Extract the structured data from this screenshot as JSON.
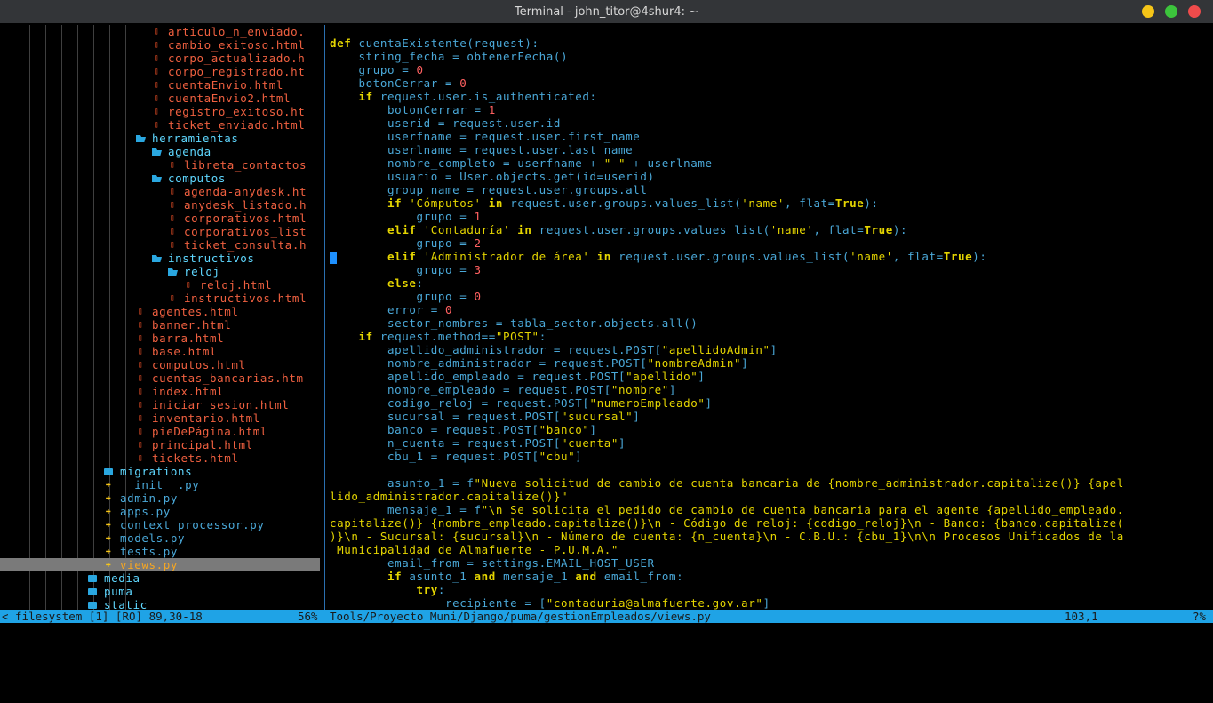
{
  "window": {
    "title": "Terminal - john_titor@4shur4: ~",
    "buttons": {
      "minimize_color": "#f5c518",
      "maximize_color": "#3cc43c",
      "close_color": "#ef4b4b"
    }
  },
  "tree": {
    "items": [
      {
        "name": "articulo_n_enviado.",
        "kind": "html",
        "indent": 10
      },
      {
        "name": "cambio_exitoso.html",
        "kind": "html",
        "indent": 10
      },
      {
        "name": "corpo_actualizado.h",
        "kind": "html",
        "indent": 10
      },
      {
        "name": "corpo_registrado.ht",
        "kind": "html",
        "indent": 10
      },
      {
        "name": "cuentaEnvio.html",
        "kind": "html",
        "indent": 10
      },
      {
        "name": "cuentaEnvio2.html",
        "kind": "html",
        "indent": 10
      },
      {
        "name": "registro_exitoso.ht",
        "kind": "html",
        "indent": 10
      },
      {
        "name": "ticket_enviado.html",
        "kind": "html",
        "indent": 10
      },
      {
        "name": "herramientas",
        "kind": "dir-open",
        "indent": 9
      },
      {
        "name": "agenda",
        "kind": "dir-open",
        "indent": 10
      },
      {
        "name": "libreta_contactos",
        "kind": "html",
        "indent": 11
      },
      {
        "name": "computos",
        "kind": "dir-open",
        "indent": 10
      },
      {
        "name": "agenda-anydesk.ht",
        "kind": "html",
        "indent": 11
      },
      {
        "name": "anydesk_listado.h",
        "kind": "html",
        "indent": 11
      },
      {
        "name": "corporativos.html",
        "kind": "html",
        "indent": 11
      },
      {
        "name": "corporativos_list",
        "kind": "html",
        "indent": 11
      },
      {
        "name": "ticket_consulta.h",
        "kind": "html",
        "indent": 11
      },
      {
        "name": "instructivos",
        "kind": "dir-open",
        "indent": 10
      },
      {
        "name": "reloj",
        "kind": "dir-open",
        "indent": 11
      },
      {
        "name": "reloj.html",
        "kind": "html",
        "indent": 12
      },
      {
        "name": "instructivos.html",
        "kind": "html",
        "indent": 11
      },
      {
        "name": "agentes.html",
        "kind": "html",
        "indent": 9
      },
      {
        "name": "banner.html",
        "kind": "html",
        "indent": 9
      },
      {
        "name": "barra.html",
        "kind": "html",
        "indent": 9
      },
      {
        "name": "base.html",
        "kind": "html",
        "indent": 9
      },
      {
        "name": "computos.html",
        "kind": "html",
        "indent": 9
      },
      {
        "name": "cuentas_bancarias.htm",
        "kind": "html",
        "indent": 9
      },
      {
        "name": "index.html",
        "kind": "html",
        "indent": 9
      },
      {
        "name": "iniciar_sesion.html",
        "kind": "html",
        "indent": 9
      },
      {
        "name": "inventario.html",
        "kind": "html",
        "indent": 9
      },
      {
        "name": "pieDePágina.html",
        "kind": "html",
        "indent": 9
      },
      {
        "name": "principal.html",
        "kind": "html",
        "indent": 9
      },
      {
        "name": "tickets.html",
        "kind": "html",
        "indent": 9
      },
      {
        "name": "migrations",
        "kind": "dir",
        "indent": 7
      },
      {
        "name": "__init__.py",
        "kind": "py",
        "indent": 7
      },
      {
        "name": "admin.py",
        "kind": "py",
        "indent": 7
      },
      {
        "name": "apps.py",
        "kind": "py",
        "indent": 7
      },
      {
        "name": "context_processor.py",
        "kind": "py",
        "indent": 7
      },
      {
        "name": "models.py",
        "kind": "py",
        "indent": 7
      },
      {
        "name": "tests.py",
        "kind": "py",
        "indent": 7
      },
      {
        "name": "views.py",
        "kind": "py",
        "indent": 7,
        "selected": true
      },
      {
        "name": "media",
        "kind": "dir",
        "indent": 6
      },
      {
        "name": "puma",
        "kind": "dir",
        "indent": 6
      },
      {
        "name": "static",
        "kind": "dir",
        "indent": 6
      }
    ]
  },
  "editor": {
    "lines": [
      [
        [
          "kw",
          "def "
        ],
        [
          "fn",
          "cuentaExistente"
        ],
        [
          "tx",
          "(request):"
        ]
      ],
      [
        [
          "tx",
          "    string_fecha = obtenerFecha()"
        ]
      ],
      [
        [
          "tx",
          "    grupo = "
        ],
        [
          "nm",
          "0"
        ]
      ],
      [
        [
          "tx",
          "    botonCerrar = "
        ],
        [
          "nm",
          "0"
        ]
      ],
      [
        [
          "tx",
          "    "
        ],
        [
          "kw",
          "if "
        ],
        [
          "tx",
          "request.user.is_authenticated:"
        ]
      ],
      [
        [
          "tx",
          "        botonCerrar = "
        ],
        [
          "nm",
          "1"
        ]
      ],
      [
        [
          "tx",
          "        userid = request.user.id"
        ]
      ],
      [
        [
          "tx",
          "        userfname = request.user.first_name"
        ]
      ],
      [
        [
          "tx",
          "        userlname = request.user.last_name"
        ]
      ],
      [
        [
          "tx",
          "        nombre_completo = userfname + "
        ],
        [
          "st",
          "\" \""
        ],
        [
          "tx",
          " + userlname"
        ]
      ],
      [
        [
          "tx",
          "        usuario = User.objects.get(id=userid)"
        ]
      ],
      [
        [
          "tx",
          "        group_name = request.user.groups.all"
        ]
      ],
      [
        [
          "tx",
          "        "
        ],
        [
          "kw",
          "if "
        ],
        [
          "st",
          "'Cómputos'"
        ],
        [
          "kw",
          " in "
        ],
        [
          "tx",
          "request.user.groups.values_list("
        ],
        [
          "st",
          "'name'"
        ],
        [
          "tx",
          ", flat="
        ],
        [
          "kw",
          "True"
        ],
        [
          "tx",
          "):"
        ]
      ],
      [
        [
          "tx",
          "            grupo = "
        ],
        [
          "nm",
          "1"
        ]
      ],
      [
        [
          "tx",
          "        "
        ],
        [
          "kw",
          "elif "
        ],
        [
          "st",
          "'Contaduría'"
        ],
        [
          "kw",
          " in "
        ],
        [
          "tx",
          "request.user.groups.values_list("
        ],
        [
          "st",
          "'name'"
        ],
        [
          "tx",
          ", flat="
        ],
        [
          "kw",
          "True"
        ],
        [
          "tx",
          "):"
        ]
      ],
      [
        [
          "tx",
          "            grupo = "
        ],
        [
          "nm",
          "2"
        ]
      ],
      [
        [
          "tx",
          "        "
        ],
        [
          "kw",
          "elif "
        ],
        [
          "st",
          "'Administrador de área'"
        ],
        [
          "kw",
          " in "
        ],
        [
          "tx",
          "request.user.groups.values_list("
        ],
        [
          "st",
          "'name'"
        ],
        [
          "tx",
          ", flat="
        ],
        [
          "kw",
          "True"
        ],
        [
          "tx",
          "):"
        ]
      ],
      [
        [
          "tx",
          "            grupo = "
        ],
        [
          "nm",
          "3"
        ]
      ],
      [
        [
          "tx",
          "        "
        ],
        [
          "kw",
          "else"
        ],
        [
          "tx",
          ":"
        ]
      ],
      [
        [
          "tx",
          "            grupo = "
        ],
        [
          "nm",
          "0"
        ]
      ],
      [
        [
          "tx",
          "        error = "
        ],
        [
          "nm",
          "0"
        ]
      ],
      [
        [
          "tx",
          "        sector_nombres = tabla_sector.objects.all()"
        ]
      ],
      [
        [
          "tx",
          "    "
        ],
        [
          "kw",
          "if "
        ],
        [
          "tx",
          "request.method=="
        ],
        [
          "st",
          "\"POST\""
        ],
        [
          "tx",
          ":"
        ]
      ],
      [
        [
          "tx",
          "        apellido_administrador = request.POST["
        ],
        [
          "st",
          "\"apellidoAdmin\""
        ],
        [
          "tx",
          "]"
        ]
      ],
      [
        [
          "tx",
          "        nombre_administrador = request.POST["
        ],
        [
          "st",
          "\"nombreAdmin\""
        ],
        [
          "tx",
          "]"
        ]
      ],
      [
        [
          "tx",
          "        apellido_empleado = request.POST["
        ],
        [
          "st",
          "\"apellido\""
        ],
        [
          "tx",
          "]"
        ]
      ],
      [
        [
          "tx",
          "        nombre_empleado = request.POST["
        ],
        [
          "st",
          "\"nombre\""
        ],
        [
          "tx",
          "]"
        ]
      ],
      [
        [
          "tx",
          "        codigo_reloj = request.POST["
        ],
        [
          "st",
          "\"numeroEmpleado\""
        ],
        [
          "tx",
          "]"
        ]
      ],
      [
        [
          "tx",
          "        sucursal = request.POST["
        ],
        [
          "st",
          "\"sucursal\""
        ],
        [
          "tx",
          "]"
        ]
      ],
      [
        [
          "tx",
          "        banco = request.POST["
        ],
        [
          "st",
          "\"banco\""
        ],
        [
          "tx",
          "]"
        ]
      ],
      [
        [
          "tx",
          "        n_cuenta = request.POST["
        ],
        [
          "st",
          "\"cuenta\""
        ],
        [
          "tx",
          "]"
        ]
      ],
      [
        [
          "tx",
          "        cbu_1 = request.POST["
        ],
        [
          "st",
          "\"cbu\""
        ],
        [
          "tx",
          "]"
        ]
      ],
      [
        [
          "tx",
          ""
        ]
      ],
      [
        [
          "tx",
          "        asunto_1 = f"
        ],
        [
          "st",
          "\"Nueva solicitud de cambio de cuenta bancaria de {nombre_administrador.capitalize()} {apel"
        ]
      ],
      [
        [
          "st",
          "lido_administrador.capitalize()}\""
        ]
      ],
      [
        [
          "tx",
          "        mensaje_1 = f"
        ],
        [
          "st",
          "\"\\n Se solicita el pedido de cambio de cuenta bancaria para el agente {apellido_empleado."
        ]
      ],
      [
        [
          "st",
          "capitalize()} {nombre_empleado.capitalize()}\\n - Código de reloj: {codigo_reloj}\\n - Banco: {banco.capitalize("
        ]
      ],
      [
        [
          "st",
          ")}\\n - Sucursal: {sucursal}\\n - Número de cuenta: {n_cuenta}\\n - C.B.U.: {cbu_1}\\n\\n Procesos Unificados de la"
        ]
      ],
      [
        [
          "st",
          " Municipalidad de Almafuerte - P.U.M.A.\""
        ]
      ],
      [
        [
          "tx",
          "        email_from = settings.EMAIL_HOST_USER"
        ]
      ],
      [
        [
          "tx",
          "        "
        ],
        [
          "kw",
          "if "
        ],
        [
          "tx",
          "asunto_1 "
        ],
        [
          "kw",
          "and "
        ],
        [
          "tx",
          "mensaje_1 "
        ],
        [
          "kw",
          "and "
        ],
        [
          "tx",
          "email_from:"
        ]
      ],
      [
        [
          "tx",
          "            "
        ],
        [
          "kw",
          "try"
        ],
        [
          "tx",
          ":"
        ]
      ],
      [
        [
          "tx",
          "                recipiente = ["
        ],
        [
          "st",
          "\"contaduria@almafuerte.gov.ar\""
        ],
        [
          "tx",
          "]"
        ]
      ]
    ]
  },
  "statusbar": {
    "left": "< filesystem [1] [RO] 89,30-18",
    "percent": "56%",
    "path": "Tools/Proyecto Muni/Django/puma/gestionEmpleados/views.py",
    "position": "103,1",
    "right": "?%"
  }
}
